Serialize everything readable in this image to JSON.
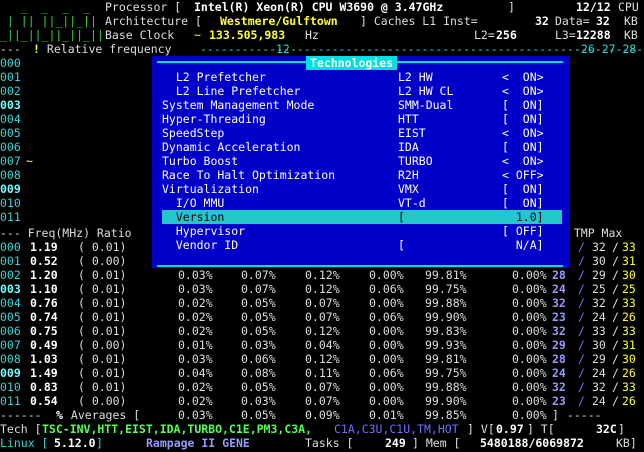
{
  "colors": {
    "background": "#000000",
    "popup": "#0000c8",
    "accent": "#00e0e0",
    "green": "#3bd43b",
    "yellow": "#ffff33",
    "blue": "#7070ff"
  },
  "header": {
    "row1": {
      "dashes": "   _  _  _  _",
      "label": "Processor [",
      "cpu": "Intel(R) Xeon(R) CPU W3690 @ 3.47GHz",
      "close": "]",
      "count": "12/12",
      "unit": "CPU"
    },
    "row2": {
      "bars": " | || ||_||_||",
      "label": "Architecture [",
      "arch": "Westmere/Gulftown",
      "close": "] Caches L1 Inst=",
      "l1i": "32",
      "data_lbl": "Data=",
      "l1d": "32",
      "kb": "KB"
    },
    "row3": {
      "bars": "_||_||_||_||_||",
      "label": "Base Clock ",
      "tilde": "~",
      "clock": "133.505,983",
      "hz": "Hz",
      "l2lbl": "L2=",
      "l2": "256",
      "l3lbl": "L3=",
      "l3": "12288",
      "kb": "KB"
    },
    "row4": {
      "prefix": "--- ",
      "bang": "!",
      "label": " Relative frequency ",
      "dashes": "-----------------------------------------------------------------",
      "mark12": "12",
      "tail": "-26-27-28"
    }
  },
  "cpu_ids": [
    "000",
    "001",
    "002",
    "003",
    "004",
    "005",
    "006",
    "007",
    "008",
    "009",
    "010",
    "011"
  ],
  "popup": {
    "title": "Technologies",
    "items": [
      {
        "name": "  L2 Prefetcher",
        "value": "L2 HW",
        "state": "<  ON>"
      },
      {
        "name": "  L2 Line Prefetcher",
        "value": "L2 HW CL",
        "state": "<  ON>"
      },
      {
        "name": "System Management Mode",
        "value": "SMM-Dual",
        "state": "[  ON]"
      },
      {
        "name": "Hyper-Threading",
        "value": "HTT",
        "state": "[  ON]"
      },
      {
        "name": "SpeedStep",
        "value": "EIST",
        "state": "<  ON>"
      },
      {
        "name": "Dynamic Acceleration",
        "value": "IDA",
        "state": "[  ON]"
      },
      {
        "name": "Turbo Boost",
        "value": "TURBO",
        "state": "<  ON>"
      },
      {
        "name": "Race To Halt Optimization",
        "value": "R2H",
        "state": "< OFF>"
      },
      {
        "name": "Virtualization",
        "value": "VMX",
        "state": "[  ON]"
      },
      {
        "name": "  I/O MMU",
        "value": "VT-d",
        "state": "[  ON]"
      },
      {
        "name": "  Version",
        "value": "[",
        "state": "  1.0]"
      },
      {
        "name": "  Hypervisor",
        "value": "",
        "state": "[ OFF]"
      },
      {
        "name": "  Vendor ID",
        "value": "[",
        "state": "  N/A]"
      }
    ],
    "selected_index": 10
  },
  "table": {
    "header_left": "--- Freq(MHz) Ratio",
    "header_right": "n TMP Max",
    "rows": [
      {
        "id": "000",
        "freq": "1.19",
        "ratio": "( 0.01)",
        "c1": "",
        "c2": "",
        "c3": "",
        "c6": "",
        "c7": "",
        "pc": "",
        "tmin": "",
        "tmp": "32",
        "tmax": "33"
      },
      {
        "id": "001",
        "freq": "0.52",
        "ratio": "( 0.00)",
        "c1": "",
        "c2": "",
        "c3": "",
        "c6": "",
        "c7": "",
        "pc": "",
        "tmin": "",
        "tmp": "30",
        "tmax": "31"
      },
      {
        "id": "002",
        "freq": "1.20",
        "ratio": "( 0.01)",
        "c1": "0.03%",
        "c2": "0.07%",
        "c3": "0.12%",
        "c6": "0.00%",
        "c7": "99.81%",
        "pc": "0.00%",
        "tmin": "28",
        "tmp": "29",
        "tmax": "30"
      },
      {
        "id": "003",
        "freq": "1.10",
        "ratio": "( 0.01)",
        "c1": "0.03%",
        "c2": "0.07%",
        "c3": "0.12%",
        "c6": "0.06%",
        "c7": "99.75%",
        "pc": "0.00%",
        "tmin": "24",
        "tmp": "25",
        "tmax": "25"
      },
      {
        "id": "004",
        "freq": "0.76",
        "ratio": "( 0.01)",
        "c1": "0.02%",
        "c2": "0.05%",
        "c3": "0.07%",
        "c6": "0.00%",
        "c7": "99.88%",
        "pc": "0.00%",
        "tmin": "32",
        "tmp": "32",
        "tmax": "33"
      },
      {
        "id": "005",
        "freq": "0.74",
        "ratio": "( 0.01)",
        "c1": "0.02%",
        "c2": "0.05%",
        "c3": "0.07%",
        "c6": "0.06%",
        "c7": "99.90%",
        "pc": "0.00%",
        "tmin": "23",
        "tmp": "24",
        "tmax": "26"
      },
      {
        "id": "006",
        "freq": "0.75",
        "ratio": "( 0.01)",
        "c1": "0.02%",
        "c2": "0.05%",
        "c3": "0.12%",
        "c6": "0.00%",
        "c7": "99.83%",
        "pc": "0.00%",
        "tmin": "32",
        "tmp": "33",
        "tmax": "33"
      },
      {
        "id": "007",
        "freq": "0.49",
        "ratio": "( 0.00)",
        "c1": "0.01%",
        "c2": "0.03%",
        "c3": "0.04%",
        "c6": "0.00%",
        "c7": "99.93%",
        "pc": "0.00%",
        "tmin": "29",
        "tmp": "30",
        "tmax": "31"
      },
      {
        "id": "008",
        "freq": "1.03",
        "ratio": "( 0.01)",
        "c1": "0.03%",
        "c2": "0.06%",
        "c3": "0.12%",
        "c6": "0.00%",
        "c7": "99.81%",
        "pc": "0.00%",
        "tmin": "28",
        "tmp": "29",
        "tmax": "30"
      },
      {
        "id": "009",
        "freq": "1.49",
        "ratio": "( 0.01)",
        "c1": "0.04%",
        "c2": "0.08%",
        "c3": "0.11%",
        "c6": "0.06%",
        "c7": "99.75%",
        "pc": "0.00%",
        "tmin": "24",
        "tmp": "24",
        "tmax": "26"
      },
      {
        "id": "010",
        "freq": "0.83",
        "ratio": "( 0.01)",
        "c1": "0.02%",
        "c2": "0.05%",
        "c3": "0.07%",
        "c6": "0.00%",
        "c7": "99.88%",
        "pc": "0.00%",
        "tmin": "32",
        "tmp": "32",
        "tmax": "33"
      },
      {
        "id": "011",
        "freq": "0.54",
        "ratio": "( 0.00)",
        "c1": "0.02%",
        "c2": "0.03%",
        "c3": "0.07%",
        "c6": "0.00%",
        "c7": "99.90%",
        "pc": "0.00%",
        "tmin": "23",
        "tmp": "24",
        "tmax": "26"
      }
    ],
    "averages": {
      "prefix": "------ ",
      "pct": "%",
      "label": " Averages [",
      "c1": "0.03%",
      "c2": "0.05%",
      "c3": "0.09%",
      "c6": "0.01%",
      "c7": "99.85%",
      "pc": "0.00%",
      "close": "]",
      "tail": " -----"
    }
  },
  "footer": {
    "tech_label": "Tech [",
    "tech_on": "TSC-INV,HTT,EIST,IDA,TURBO,C1E,PM3,C3A,",
    "tech_off": "C1A,C3U,C1U,TM,HOT",
    "tech_close": "]",
    "v_label": " V[",
    "v_val": "0.97",
    "t_label": "] T[",
    "t_val": "32C",
    "t_close": "]",
    "os": "Linux [",
    "kernel": "5.12.0",
    "os_close": "]",
    "board": "Rampage II GENE",
    "tasks_label": "Tasks [",
    "tasks": "249",
    "mem_label": "] Mem [",
    "mem": "5480188/6069872",
    "mem_unit": "KB]"
  }
}
